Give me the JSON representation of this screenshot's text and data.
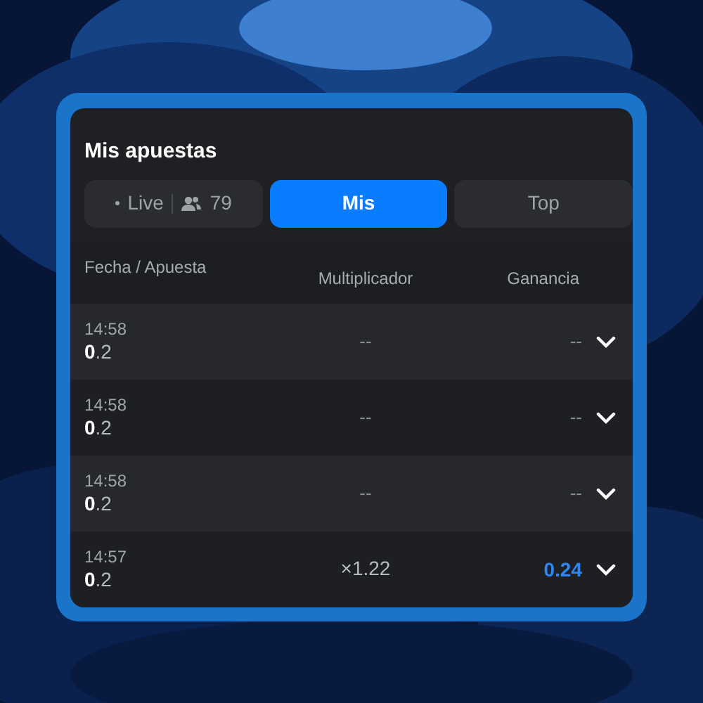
{
  "panel": {
    "title": "Mis apuestas"
  },
  "tabs": [
    {
      "kind": "live",
      "label": "Live",
      "count": "79",
      "selected": false
    },
    {
      "kind": "plain",
      "label": "Mis",
      "selected": true
    },
    {
      "kind": "plain",
      "label": "Top",
      "selected": false
    }
  ],
  "table": {
    "columns": [
      "Fecha / Apuesta",
      "Multiplicador",
      "Ganancia"
    ],
    "rows": [
      {
        "time": "14:58",
        "bet": "**0**.2",
        "multiplier": "--",
        "payout": "--",
        "won": false
      },
      {
        "time": "14:58",
        "bet": "**0**.2",
        "multiplier": "--",
        "payout": "--",
        "won": false
      },
      {
        "time": "14:58",
        "bet": "**0**.2",
        "multiplier": "--",
        "payout": "--",
        "won": false
      },
      {
        "time": "14:57",
        "bet": "**0**.2",
        "multiplier": "×1.22",
        "payout": "0.24",
        "won": true
      }
    ]
  }
}
